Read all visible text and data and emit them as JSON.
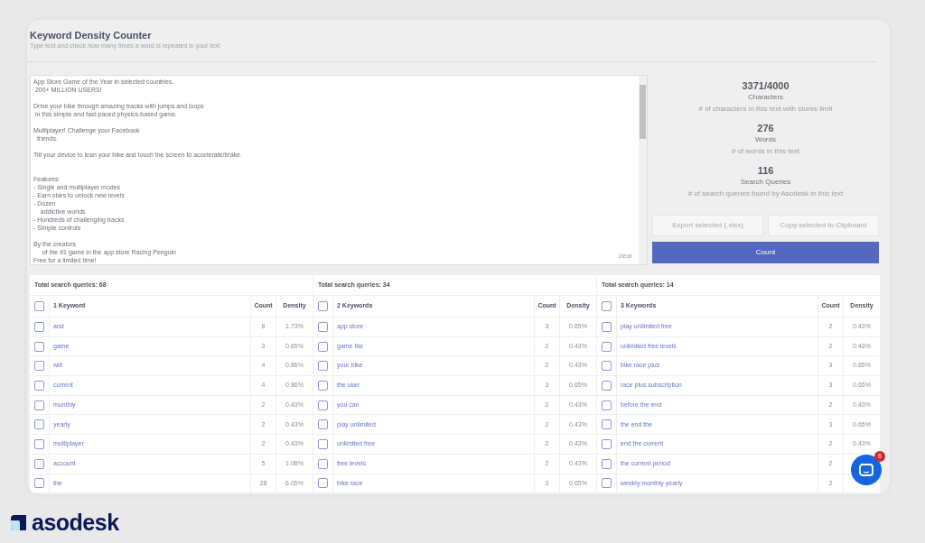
{
  "page": {
    "title": "Keyword Density Counter",
    "subtitle": "Type text and check how many times a word is repeated in your text"
  },
  "editor": {
    "text": "App Store Game of the Year in selected countries.\n 200+ MILLION USERS!\n\nDrive your bike through amazing tracks with jumps and loops\n in this simple and fast-paced physics-based game.\n\nMultiplayer! Challenge your Facebook\n  friends.\n\nTilt your device to lean your bike and touch the screen to accelerate/brake.\n\n\nFeatures:\n- Single and multiplayer modes\n- Earn stars to unlock new levels\n- Dozen\n    addictive worlds\n- Hundreds of challenging tracks\n- Simple controls\n\nBy the creators\n     of the #1 game in the app store Racing Penguin\nFree for a limited time!",
    "clear_label": "clear"
  },
  "stats": [
    {
      "value": "3371/4000",
      "label": "Characters",
      "hint": "# of characters in this text with stores limit"
    },
    {
      "value": "276",
      "label": "Words",
      "hint": "# of words in this text"
    },
    {
      "value": "116",
      "label": "Search Queries",
      "hint": "# of search queries found by Asodesk in this text"
    }
  ],
  "buttons": [
    {
      "label": "Export selected (.xlsx)",
      "kind": "secondary"
    },
    {
      "label": "Copy selected to Clipboard",
      "kind": "secondary"
    },
    {
      "label": "Count",
      "kind": "primary"
    }
  ],
  "tables": [
    {
      "total": "Total search queries: 68",
      "columns": [
        "1 Keyword",
        "Count",
        "Density"
      ],
      "all_checked": false,
      "rows": [
        {
          "keyword": "and",
          "count": "8",
          "density": "1.73%",
          "checked": false
        },
        {
          "keyword": "game",
          "count": "3",
          "density": "0.65%",
          "checked": false
        },
        {
          "keyword": "will",
          "count": "4",
          "density": "0.86%",
          "checked": false
        },
        {
          "keyword": "current",
          "count": "4",
          "density": "0.86%",
          "checked": false
        },
        {
          "keyword": "monthly",
          "count": "2",
          "density": "0.43%",
          "checked": false
        },
        {
          "keyword": "yearly",
          "count": "2",
          "density": "0.43%",
          "checked": false
        },
        {
          "keyword": "multiplayer",
          "count": "2",
          "density": "0.43%",
          "checked": false
        },
        {
          "keyword": "account",
          "count": "5",
          "density": "1.08%",
          "checked": false
        },
        {
          "keyword": "the",
          "count": "28",
          "density": "6.05%",
          "checked": false
        }
      ]
    },
    {
      "total": "Total search queries: 34",
      "columns": [
        "2 Keywords",
        "Count",
        "Density"
      ],
      "all_checked": false,
      "rows": [
        {
          "keyword": "app store",
          "count": "3",
          "density": "0.65%",
          "checked": false
        },
        {
          "keyword": "game the",
          "count": "2",
          "density": "0.43%",
          "checked": false
        },
        {
          "keyword": "your bike",
          "count": "2",
          "density": "0.43%",
          "checked": false
        },
        {
          "keyword": "the user",
          "count": "3",
          "density": "0.65%",
          "checked": false
        },
        {
          "keyword": "you can",
          "count": "2",
          "density": "0.43%",
          "checked": false
        },
        {
          "keyword": "play unlimited",
          "count": "2",
          "density": "0.43%",
          "checked": false
        },
        {
          "keyword": "unlimited free",
          "count": "2",
          "density": "0.43%",
          "checked": false
        },
        {
          "keyword": "free levels",
          "count": "2",
          "density": "0.43%",
          "checked": false
        },
        {
          "keyword": "bike race",
          "count": "3",
          "density": "0.65%",
          "checked": false
        }
      ]
    },
    {
      "total": "Total search queries: 14",
      "columns": [
        "3 Keywords",
        "Count",
        "Density"
      ],
      "all_checked": false,
      "rows": [
        {
          "keyword": "play unlimited free",
          "count": "2",
          "density": "0.43%",
          "checked": false
        },
        {
          "keyword": "unlimited free levels",
          "count": "2",
          "density": "0.43%",
          "checked": false
        },
        {
          "keyword": "bike race plus",
          "count": "3",
          "density": "0.65%",
          "checked": false
        },
        {
          "keyword": "race plus subscription",
          "count": "3",
          "density": "0.65%",
          "checked": false
        },
        {
          "keyword": "before the end",
          "count": "2",
          "density": "0.43%",
          "checked": false
        },
        {
          "keyword": "the end the",
          "count": "3",
          "density": "0.65%",
          "checked": false
        },
        {
          "keyword": "end the current",
          "count": "2",
          "density": "0.43%",
          "checked": false
        },
        {
          "keyword": "the current period",
          "count": "2",
          "checked": false
        },
        {
          "keyword": "weekly monthly yearly",
          "count": "2",
          "checked": false
        }
      ]
    }
  ],
  "chat": {
    "badge": "6"
  },
  "brand": {
    "name": "asodesk"
  }
}
